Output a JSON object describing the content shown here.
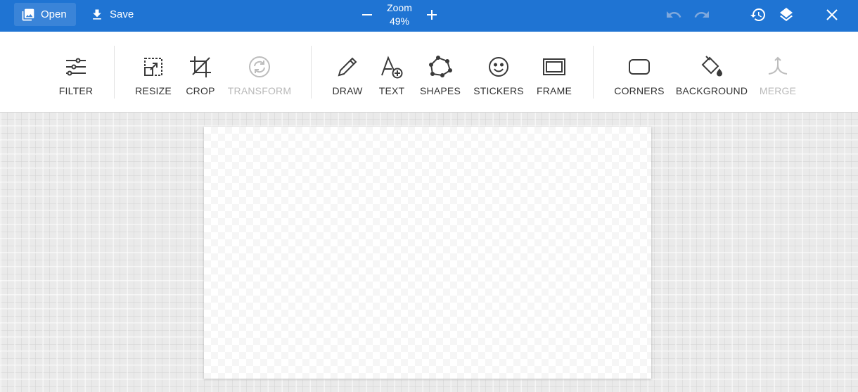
{
  "topbar": {
    "open_label": "Open",
    "save_label": "Save",
    "zoom_label": "Zoom",
    "zoom_value": "49%",
    "icons": [
      "image-icon",
      "download-icon",
      "minus-icon",
      "plus-icon",
      "undo-icon",
      "redo-icon",
      "history-icon",
      "layers-icon",
      "close-icon"
    ],
    "colors": {
      "bar": "#1f74d3",
      "disabled_icon": "#7fa8dc"
    }
  },
  "toolbar": {
    "tools": [
      {
        "label": "FILTER",
        "enabled": true
      },
      {
        "label": "RESIZE",
        "enabled": true
      },
      {
        "label": "CROP",
        "enabled": true
      },
      {
        "label": "TRANSFORM",
        "enabled": false
      },
      {
        "label": "DRAW",
        "enabled": true
      },
      {
        "label": "TEXT",
        "enabled": true
      },
      {
        "label": "SHAPES",
        "enabled": true
      },
      {
        "label": "STICKERS",
        "enabled": true
      },
      {
        "label": "FRAME",
        "enabled": true
      },
      {
        "label": "CORNERS",
        "enabled": true
      },
      {
        "label": "BACKGROUND",
        "enabled": true
      },
      {
        "label": "MERGE",
        "enabled": false
      }
    ]
  }
}
